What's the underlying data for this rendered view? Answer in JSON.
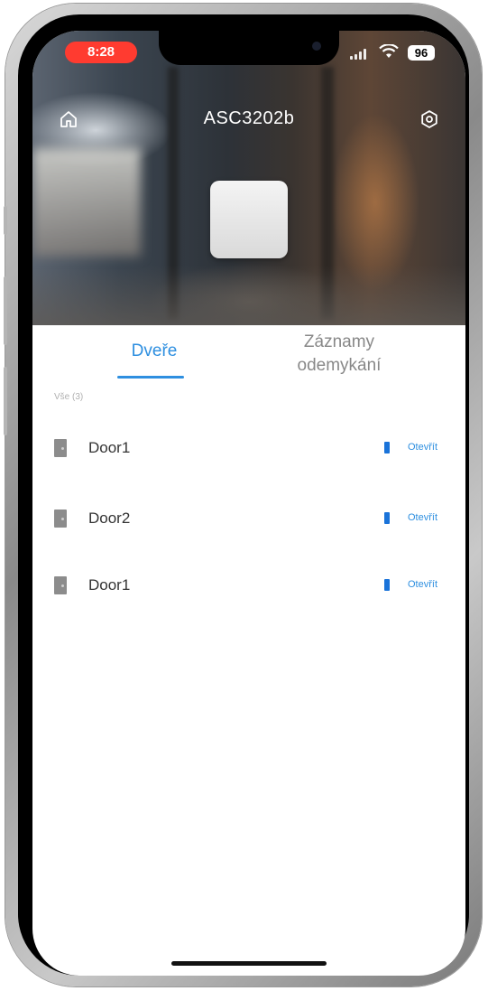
{
  "status_bar": {
    "time": "8:28",
    "battery": "96"
  },
  "header": {
    "title": "ASC3202b"
  },
  "tabs": [
    {
      "label": "Dveře",
      "active": true
    },
    {
      "label_line1": "Záznamy",
      "label_line2": "odemykání",
      "active": false
    }
  ],
  "list_count": "Vše (3)",
  "doors": [
    {
      "name": "Door1",
      "action": "Otevřít"
    },
    {
      "name": "Door2",
      "action": "Otevřít"
    },
    {
      "name": "Door1",
      "action": "Otevřít"
    }
  ],
  "colors": {
    "accent": "#2e8fe0",
    "time_pill": "#ff3b30"
  },
  "icons": {
    "home": "home-icon",
    "settings": "settings-icon",
    "door": "door-icon",
    "unlock": "unlock-icon"
  }
}
